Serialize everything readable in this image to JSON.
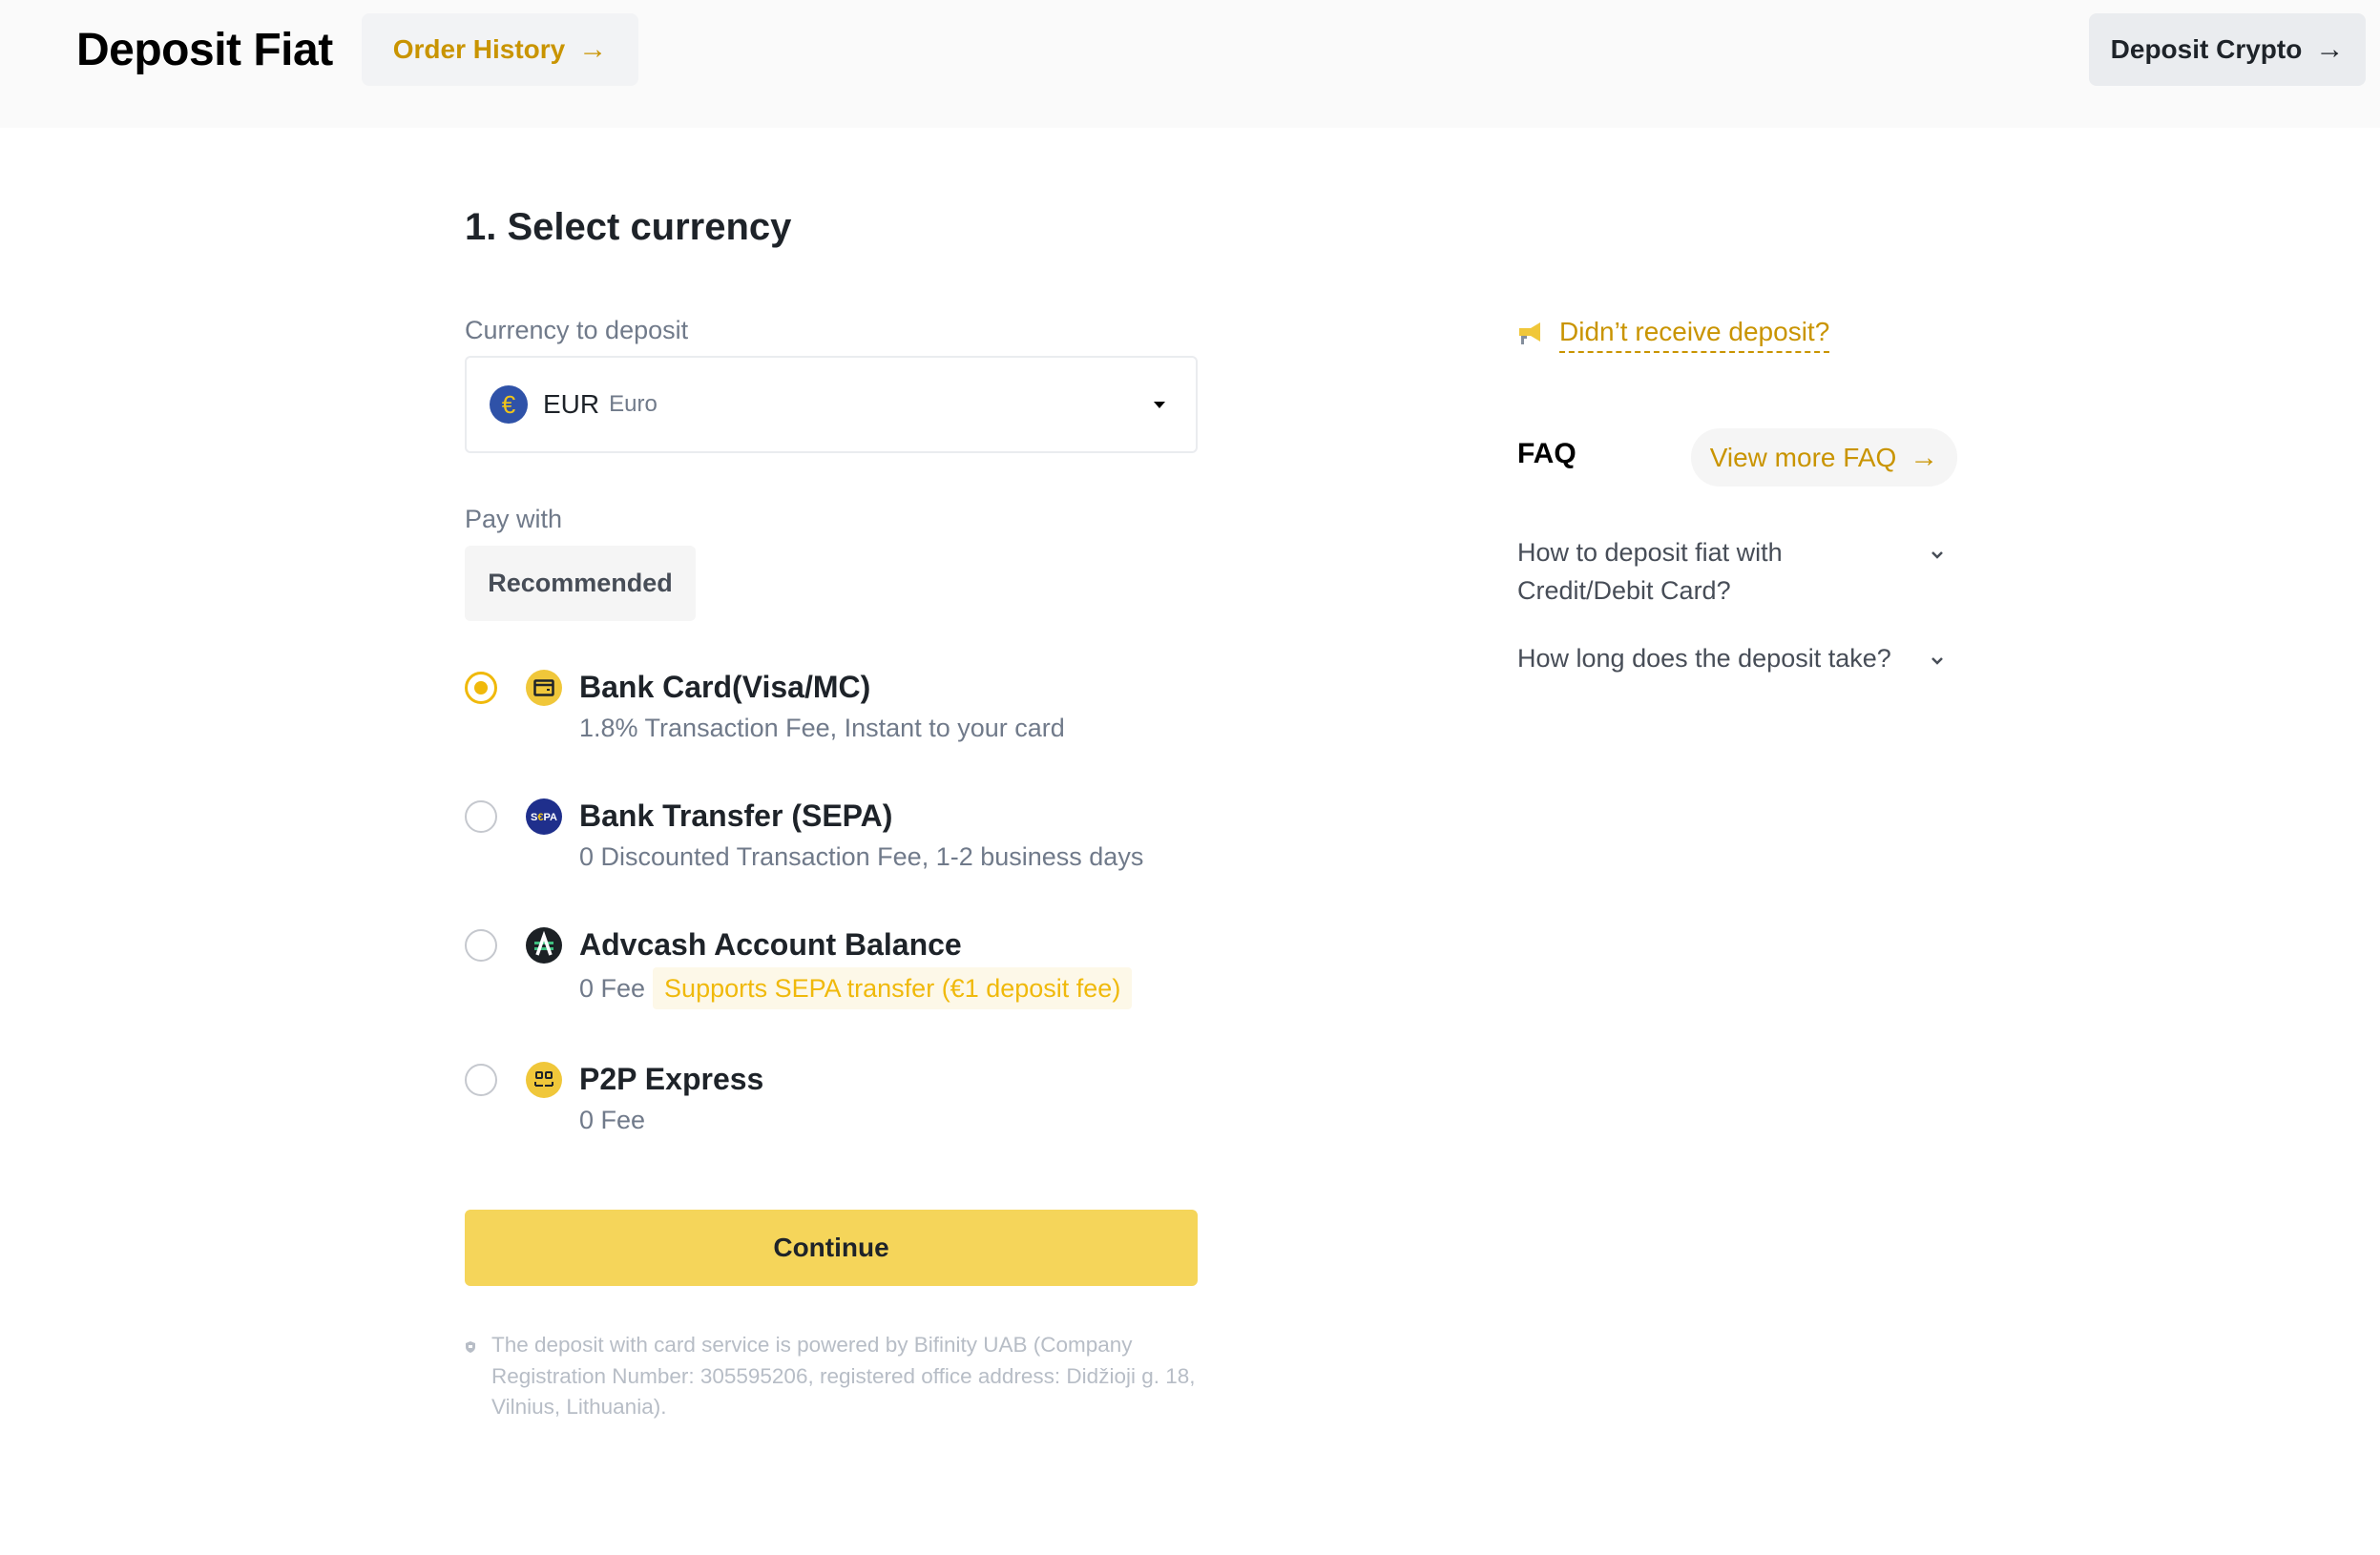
{
  "header": {
    "title": "Deposit Fiat",
    "order_history_label": "Order History",
    "deposit_crypto_label": "Deposit Crypto",
    "arrow_icon": "→"
  },
  "form": {
    "section_title": "1. Select currency",
    "currency_label": "Currency to deposit",
    "currency": {
      "icon": "€",
      "code": "EUR",
      "name": "Euro"
    },
    "pay_with_label": "Pay with",
    "filter_chip": "Recommended",
    "payment_methods": [
      {
        "title": "Bank Card(Visa/MC)",
        "subtitle": "1.8% Transaction Fee, Instant to your card",
        "badge": null,
        "icon": "card-icon",
        "selected": true
      },
      {
        "title": "Bank Transfer (SEPA)",
        "subtitle": "0 Discounted Transaction Fee, 1-2 business days",
        "badge": null,
        "icon": "sepa-icon",
        "selected": false
      },
      {
        "title": "Advcash Account Balance",
        "subtitle": "0 Fee",
        "badge": "Supports SEPA transfer (€1 deposit fee)",
        "icon": "advcash-icon",
        "selected": false
      },
      {
        "title": "P2P Express",
        "subtitle": "0 Fee",
        "badge": null,
        "icon": "p2p-icon",
        "selected": false
      }
    ],
    "continue_label": "Continue",
    "disclaimer": "The deposit with card service is powered by Bifinity UAB (Company Registration Number: 305595206, registered office address: Didžioji g. 18, Vilnius, Lithuania)."
  },
  "sidebar": {
    "notice_link": "Didn’t receive deposit?",
    "faq_title": "FAQ",
    "view_more_faq_label": "View more FAQ",
    "faq_items": [
      {
        "question": "How to deposit fiat with Credit/Debit Card?"
      },
      {
        "question": "How long does the deposit take?"
      }
    ]
  },
  "colors": {
    "accent": "#f0b90b",
    "accent_text": "#c99400",
    "button_primary": "#f5d55a",
    "header_bg": "#fafafa"
  }
}
